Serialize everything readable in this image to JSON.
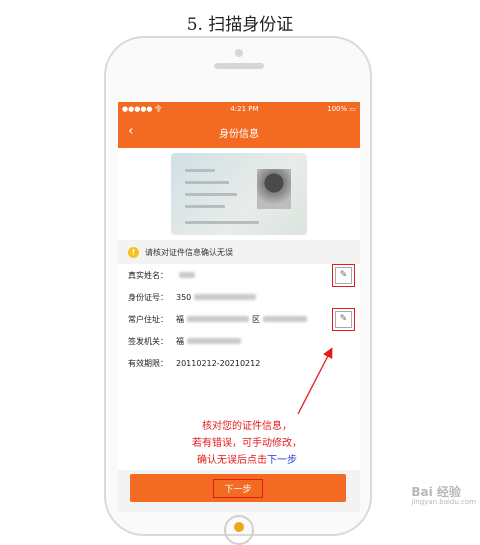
{
  "caption": "5. 扫描身份证",
  "status_bar": {
    "signal": "●●●●● 令",
    "time": "4:21 PM",
    "battery": "100% ▭"
  },
  "navbar": {
    "back": "‹",
    "title": "身份信息"
  },
  "notice": {
    "icon": "!",
    "text": "请核对证件信息确认无误"
  },
  "form": {
    "rows": [
      {
        "label": "真实姓名：",
        "value": ""
      },
      {
        "label": "身份证号：",
        "value": "350"
      },
      {
        "label": "常户住址：",
        "value": "福",
        "value_tail": "区"
      },
      {
        "label": "签发机关：",
        "value": "福"
      },
      {
        "label": "有效期限：",
        "value": "20110212-20210212"
      }
    ],
    "edit_icon": "✎"
  },
  "next_button": "下一步",
  "annotation": {
    "line1": "核对您的证件信息，",
    "line2": "若有错误，可手动修改，",
    "line3_prefix": "确认无误后点击",
    "line3_link": "下一步"
  },
  "watermark": {
    "brand": "Bai 经验",
    "url": "jingyan.baidu.com"
  },
  "colors": {
    "accent": "#f36a22",
    "annotation": "#e31b1b",
    "link": "#1f3bd8"
  },
  "icons": [
    "back-icon",
    "warning-icon",
    "edit-icon",
    "home-button-icon"
  ]
}
